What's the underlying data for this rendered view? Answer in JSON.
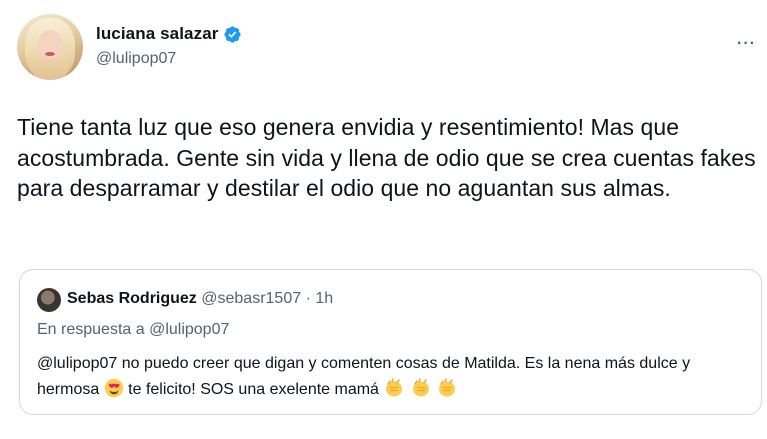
{
  "author": {
    "display_name": "luciana salazar",
    "handle": "@lulipop07",
    "verified": true
  },
  "icons": {
    "verified": "verified-badge-icon",
    "more": "more-options-icon",
    "heart_eyes": "smiling-face-with-heart-eyes-emoji",
    "clap": "clapping-hands-emoji"
  },
  "colors": {
    "verified_blue": "#1d9bf0",
    "secondary_text": "#536471",
    "border": "#cfd9de"
  },
  "tweet": {
    "more_label": "···",
    "text": "Tiene tanta luz que eso genera envidia y resentimiento! Mas que acostumbrada. Gente sin vida y llena de odio que se crea cuentas fakes para desparramar y destilar el odio que no aguantan sus almas."
  },
  "quoted": {
    "display_name": "Sebas Rodriguez",
    "handle": "@sebasr1507",
    "separator": "·",
    "time": "1h",
    "reply_prefix": "En respuesta a",
    "reply_to": "@lulipop07",
    "text_part1": "@lulipop07 no puedo creer que digan y comenten cosas de Matilda. Es la nena más dulce y hermosa",
    "text_part2": "te felicito! SOS una exelente mamá"
  }
}
